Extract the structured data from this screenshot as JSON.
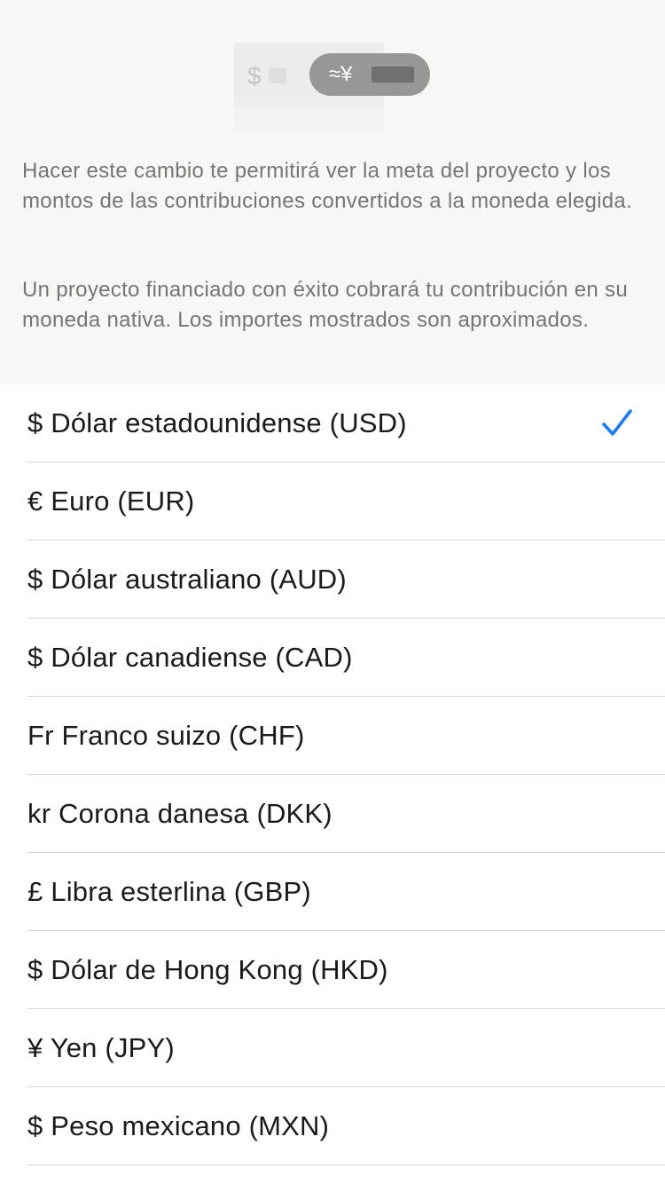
{
  "illustration": {
    "left_symbol": "$",
    "right_symbol": "≈¥"
  },
  "info": {
    "paragraph_1": "Hacer este cambio te permitirá ver la meta del proyecto y los montos de las contribuciones convertidos a la moneda elegida.",
    "paragraph_2": "Un proyecto financiado con éxito cobrará tu contribución en su moneda nativa. Los importes mostrados son aproximados."
  },
  "currencies": [
    {
      "label": "$ Dólar estadounidense (USD)",
      "selected": true
    },
    {
      "label": "€ Euro (EUR)",
      "selected": false
    },
    {
      "label": "$ Dólar australiano (AUD)",
      "selected": false
    },
    {
      "label": "$ Dólar canadiense (CAD)",
      "selected": false
    },
    {
      "label": "Fr Franco suizo (CHF)",
      "selected": false
    },
    {
      "label": "kr Corona danesa (DKK)",
      "selected": false
    },
    {
      "label": "£ Libra esterlina (GBP)",
      "selected": false
    },
    {
      "label": "$ Dólar de Hong Kong (HKD)",
      "selected": false
    },
    {
      "label": "¥ Yen (JPY)",
      "selected": false
    },
    {
      "label": "$ Peso mexicano (MXN)",
      "selected": false
    }
  ],
  "colors": {
    "accent": "#1a7cf5",
    "header_background": "#f7f7f5",
    "secondary_text": "#757575",
    "divider": "#d6d6d6"
  },
  "icons": {
    "selected_indicator": "checkmark-icon"
  }
}
